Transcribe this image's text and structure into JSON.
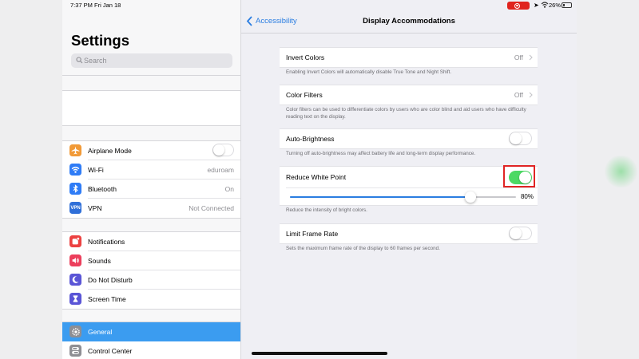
{
  "status_bar": {
    "time": "7:37 PM",
    "date": "Fri Jan 18",
    "battery_percent": "26%",
    "battery_level": 0.26
  },
  "master": {
    "title": "Settings",
    "search_placeholder": "Search",
    "group1": [
      {
        "label": "Airplane Mode",
        "value": "",
        "icon": "airplane-icon",
        "color": "#f19a37",
        "toggle": false
      },
      {
        "label": "Wi-Fi",
        "value": "eduroam",
        "icon": "wifi-icon",
        "color": "#2f7cf6"
      },
      {
        "label": "Bluetooth",
        "value": "On",
        "icon": "bluetooth-icon",
        "color": "#2f7cf6"
      },
      {
        "label": "VPN",
        "value": "Not Connected",
        "icon": "vpn-icon",
        "color": "#2f6fd8"
      }
    ],
    "group2": [
      {
        "label": "Notifications",
        "icon": "notifications-icon",
        "color": "#ec4141"
      },
      {
        "label": "Sounds",
        "icon": "sounds-icon",
        "color": "#ec3f5c"
      },
      {
        "label": "Do Not Disturb",
        "icon": "moon-icon",
        "color": "#5a55d6"
      },
      {
        "label": "Screen Time",
        "icon": "hourglass-icon",
        "color": "#5a55d6"
      }
    ],
    "group3": [
      {
        "label": "General",
        "icon": "gear-icon",
        "color": "#8e8e93",
        "selected": true
      },
      {
        "label": "Control Center",
        "icon": "control-center-icon",
        "color": "#8e8e93"
      }
    ]
  },
  "detail": {
    "back_label": "Accessibility",
    "title": "Display Accommodations",
    "invert_colors": {
      "label": "Invert Colors",
      "value": "Off",
      "footnote": "Enabling Invert Colors will automatically disable True Tone and Night Shift."
    },
    "color_filters": {
      "label": "Color Filters",
      "value": "Off",
      "footnote": "Color filters can be used to differentiate colors by users who are color blind and aid users who have difficulty reading text on the display."
    },
    "auto_brightness": {
      "label": "Auto-Brightness",
      "on": false,
      "footnote": "Turning off auto-brightness may affect battery life and long-term display performance."
    },
    "reduce_white_point": {
      "label": "Reduce White Point",
      "on": true,
      "slider_label": "80%",
      "slider_value": 0.8,
      "footnote": "Reduce the intensity of bright colors."
    },
    "limit_frame_rate": {
      "label": "Limit Frame Rate",
      "on": false,
      "footnote": "Sets the maximum frame rate of the display to 60 frames per second."
    }
  },
  "colors": {
    "accent": "#2a7de1",
    "switch_on": "#4cd964",
    "selected_row": "#3b9cf0",
    "highlight": "#e02424"
  }
}
